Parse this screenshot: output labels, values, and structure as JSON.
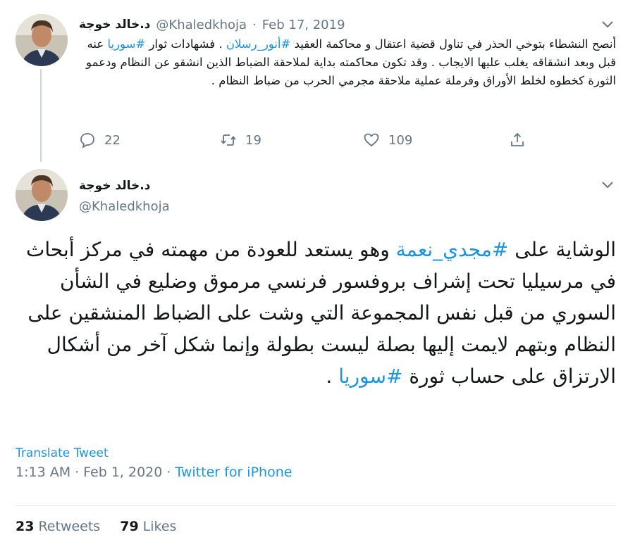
{
  "tweet1": {
    "display_name": "د.خالد خوجة",
    "handle": "@Khaledkhoja",
    "separator": "·",
    "date": "Feb 17, 2019",
    "text_part1": "أنصح النشطاء بتوخي الحذر في تناول قضية اعتقال و محاكمة العقيد ",
    "hashtag1": "#أنور_رسلان",
    "text_part2": " . فشهادات ثوار ",
    "hashtag2": "#سوريا",
    "text_part3": " عنه قبل وبعد انشقاقه يغلب عليها الايجاب . وقد تكون محاكمته بداية لملاحقة الضباط الذين انشقو عن النظام ودعمو الثورة كخطوه لخلط الأوراق وفرملة عملية ملاحقة مجرمي الحرب من ضباط النظام .",
    "reply_count": "22",
    "retweet_count": "19",
    "like_count": "109"
  },
  "tweet2": {
    "display_name": "د.خالد خوجة",
    "handle": "@Khaledkhoja",
    "text_part1": "الوشاية على ",
    "hashtag1": "#مجدي_نعمة",
    "text_part2": " وهو يستعد للعودة من مهمته في مركز أبحاث في مرسيليا تحت إشراف بروفسور فرنسي مرموق وضليع في الشأن السوري من قبل نفس المجموعة التي وشت على الضباط المنشقين على النظام وبتهم لايمت إليها بصلة ليست بطولة وإنما شكل آخر من أشكال الارتزاق على حساب ثورة ",
    "hashtag2": "#سوريا",
    "text_part3": " .",
    "translate_label": "Translate Tweet",
    "time": "1:13 AM",
    "separator": "·",
    "date": "Feb 1, 2020",
    "source": "Twitter for iPhone",
    "retweets_count": "23",
    "retweets_label": "Retweets",
    "likes_count": "79",
    "likes_label": "Likes"
  },
  "colors": {
    "link": "#1b95e0",
    "secondary_text": "#657786",
    "primary_text": "#14171a",
    "divider": "#e6ecf0"
  },
  "icons": {
    "reply": "reply-icon",
    "retweet": "retweet-icon",
    "like": "heart-icon",
    "share": "share-icon",
    "more": "chevron-down-icon"
  }
}
